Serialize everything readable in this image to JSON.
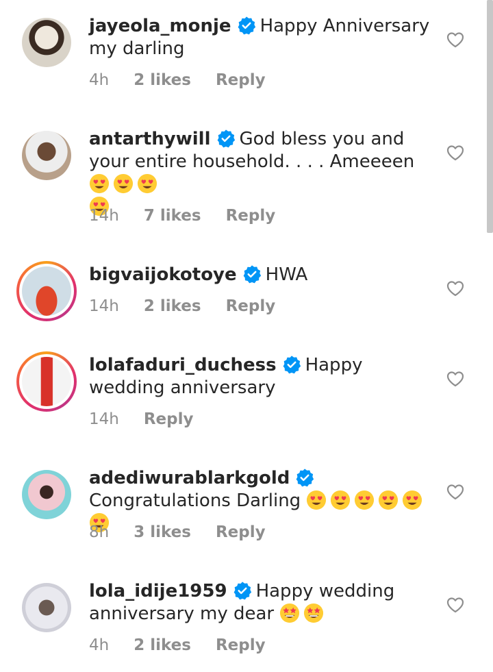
{
  "comments": [
    {
      "username": "jayeola_monje",
      "text": "Happy Anniversary my darling",
      "emojis": [],
      "time": "4h",
      "likes": "2 likes",
      "reply": "Reply",
      "avatar_colors": [
        "#e8e4dc",
        "#3a2b22"
      ]
    },
    {
      "username": "antarthywill",
      "text": "God bless you and your entire household. . . .  Ameeeen",
      "emojis": [
        "heart-eyes",
        "heart-eyes",
        "heart-eyes",
        "heart-eyes"
      ],
      "time": "14h",
      "likes": "7 likes",
      "reply": "Reply",
      "avatar_colors": [
        "#6a4a36",
        "#d8d8d8"
      ]
    },
    {
      "username": "bigvaijokotoye",
      "text": "HWA",
      "emojis": [],
      "time": "14h",
      "likes": "2 likes",
      "reply": "Reply",
      "avatar_colors": [
        "#e8eef2",
        "#e0462a"
      ]
    },
    {
      "username": "lolafaduri_duchess",
      "text": "Happy wedding anniversary",
      "emojis": [],
      "time": "14h",
      "likes": "",
      "reply": "Reply",
      "avatar_colors": [
        "#f4f4f4",
        "#d8322a"
      ]
    },
    {
      "username": "adediwurablarkgold",
      "text": "Congratulations Darling",
      "emojis": [
        "heart-eyes",
        "heart-eyes",
        "heart-eyes",
        "heart-eyes",
        "heart-eyes",
        "heart-eyes"
      ],
      "time": "8h",
      "likes": "3 likes",
      "reply": "Reply",
      "avatar_colors": [
        "#7fd3d8",
        "#f1c8d0"
      ]
    },
    {
      "username": "lola_idije1959",
      "text": "Happy wedding anniversary my dear",
      "emojis": [
        "star-struck",
        "star-struck"
      ],
      "time": "4h",
      "likes": "2 likes",
      "reply": "Reply",
      "avatar_colors": [
        "#e9e9ef",
        "#6a5a52"
      ]
    }
  ],
  "colors": {
    "text": "#262626",
    "meta": "#8e8e8e",
    "verified": "#0095f6",
    "emoji_face": "#ffcc33",
    "emoji_heart": "#ef3b50",
    "emoji_star": "#f5b400"
  }
}
